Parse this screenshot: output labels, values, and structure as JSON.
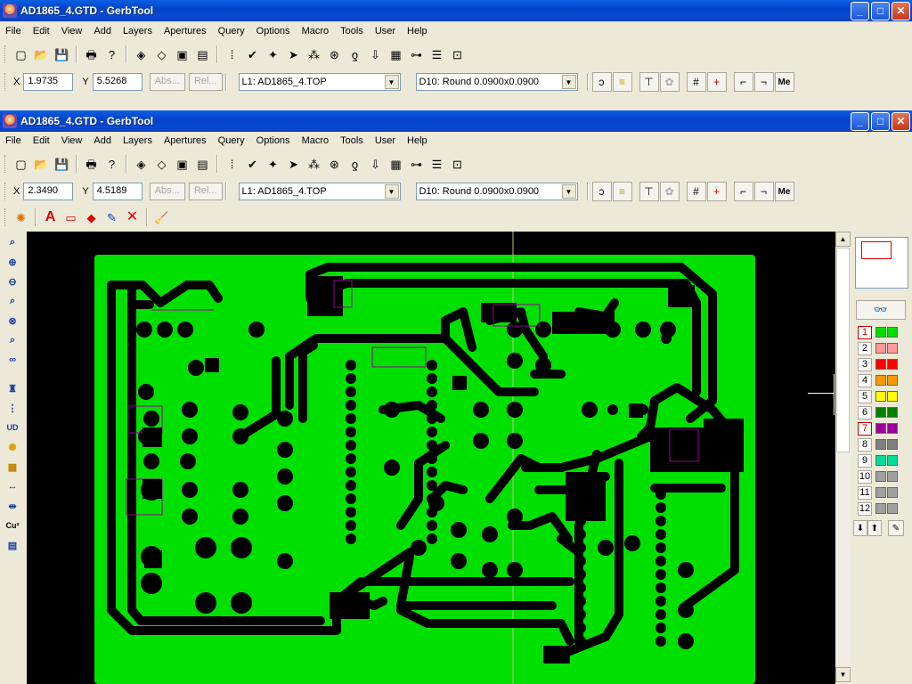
{
  "window_back": {
    "title": "AD1865_4.GTD - GerbTool"
  },
  "window_front": {
    "title": "AD1865_4.GTD - GerbTool"
  },
  "menu": [
    "File",
    "Edit",
    "View",
    "Add",
    "Layers",
    "Apertures",
    "Query",
    "Options",
    "Macro",
    "Tools",
    "User",
    "Help"
  ],
  "back_coords": {
    "x_label": "X",
    "x_value": "1.9735",
    "y_label": "Y",
    "y_value": "5.5268"
  },
  "front_coords": {
    "x_label": "X",
    "x_value": "2.3490",
    "y_label": "Y",
    "y_value": "4.5189"
  },
  "buttons": {
    "abs": "Abs...",
    "rel": "Rel...",
    "me": "Me"
  },
  "layer_select": "L1: AD1865_4.TOP",
  "aperture_select": "D10: Round 0.0900x0.0900",
  "layers": [
    {
      "num": "1",
      "color": "#00e000",
      "active": true
    },
    {
      "num": "2",
      "color": "#ff9999",
      "active": false
    },
    {
      "num": "3",
      "color": "#ff0000",
      "active": false
    },
    {
      "num": "4",
      "color": "#ff9900",
      "active": false
    },
    {
      "num": "5",
      "color": "#ffff00",
      "active": false
    },
    {
      "num": "6",
      "color": "#008000",
      "active": false
    },
    {
      "num": "7",
      "color": "#990099",
      "active": true
    },
    {
      "num": "8",
      "color": "#808080",
      "active": false
    },
    {
      "num": "9",
      "color": "#00dd99",
      "active": false
    },
    {
      "num": "10",
      "color": "#a0a0a0",
      "active": false
    },
    {
      "num": "11",
      "color": "#a0a0a0",
      "active": false
    },
    {
      "num": "12",
      "color": "#a0a0a0",
      "active": false
    }
  ],
  "colors": {
    "copper": "#00e000",
    "trace": "#000000",
    "board_bg": "#000000",
    "outline": "#990099"
  }
}
